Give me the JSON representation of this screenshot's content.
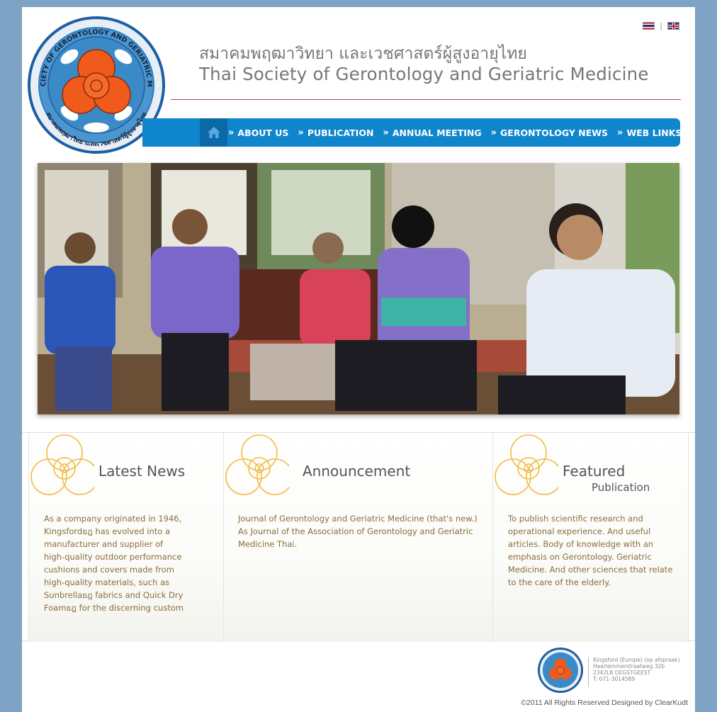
{
  "header": {
    "title_th": "สมาคมพฤฒาวิทยา และเวชศาสตร์ผู้สูงอายุไทย",
    "title_en": "Thai Society of Gerontology and Geriatric Medicine",
    "logo_text": "THAI SOCIETY OF GERONTOLOGY AND GERIATRIC MEDICINE",
    "logo_text_th": "สมาคมพฤฒาวิทยาและเวชศาสตร์ผู้สูงอายุไทย",
    "languages": [
      {
        "name": "thai-flag-icon",
        "label": "TH"
      },
      {
        "name": "uk-flag-icon",
        "label": "EN"
      }
    ],
    "flag_separator": "|"
  },
  "nav": {
    "home_icon": "home-icon",
    "items": [
      {
        "label": "ABOUT US"
      },
      {
        "label": "PUBLICATION"
      },
      {
        "label": "ANNUAL MEETING"
      },
      {
        "label": "GERONTOLOGY NEWS"
      },
      {
        "label": "WEB LINKS"
      }
    ],
    "chevron": "»"
  },
  "hero": {
    "image": "photo-elderly-woman-visitors"
  },
  "columns": {
    "latest_news": {
      "title": "Latest News",
      "lines": [
        "As a company originated in 1946,",
        "Kingsfordยฎ has evolved into a",
        "manufacturer and supplier of",
        "high-quality outdoor performance",
        "cushions and covers made from",
        "high-quality materials, such as",
        "Sunbrellaยฎ fabrics and Quick Dry",
        "Foamยฎ for the discerning custom"
      ]
    },
    "announcement": {
      "title": "Announcement",
      "lines": [
        "Journal of Gerontology and Geriatric Medicine (that's new.)",
        "As Journal of the Association of Gerontology and Geriatric",
        "Medicine Thai."
      ]
    },
    "featured": {
      "title": "Featured",
      "subtitle": "Publication",
      "lines": [
        "To publish scientific research and",
        "operational experience. And useful",
        "articles. Body of knowledge with an",
        "emphasis on Gerontology. Geriatric",
        "Medicine. And other sciences that relate",
        "to the care of the elderly."
      ]
    }
  },
  "footer": {
    "address": [
      "Kingsford (Europe) (op afspraak)",
      "Haarlemmerstraatweg 32b",
      "2342LB OEGSTGEEST",
      "T: 071-3014589"
    ],
    "copyright": "©2011 All Rights Reserved Designed by ClearKudt"
  },
  "colors": {
    "background": "#7fa3c5",
    "nav_blue": "#0f85cc",
    "nav_home": "#0a6aa8",
    "title_gray": "#777777",
    "rule_red": "#b24a4a",
    "body_text": "#8a6d3b",
    "logo_orange": "#f05a1a",
    "logo_blue": "#2d7fc1"
  }
}
